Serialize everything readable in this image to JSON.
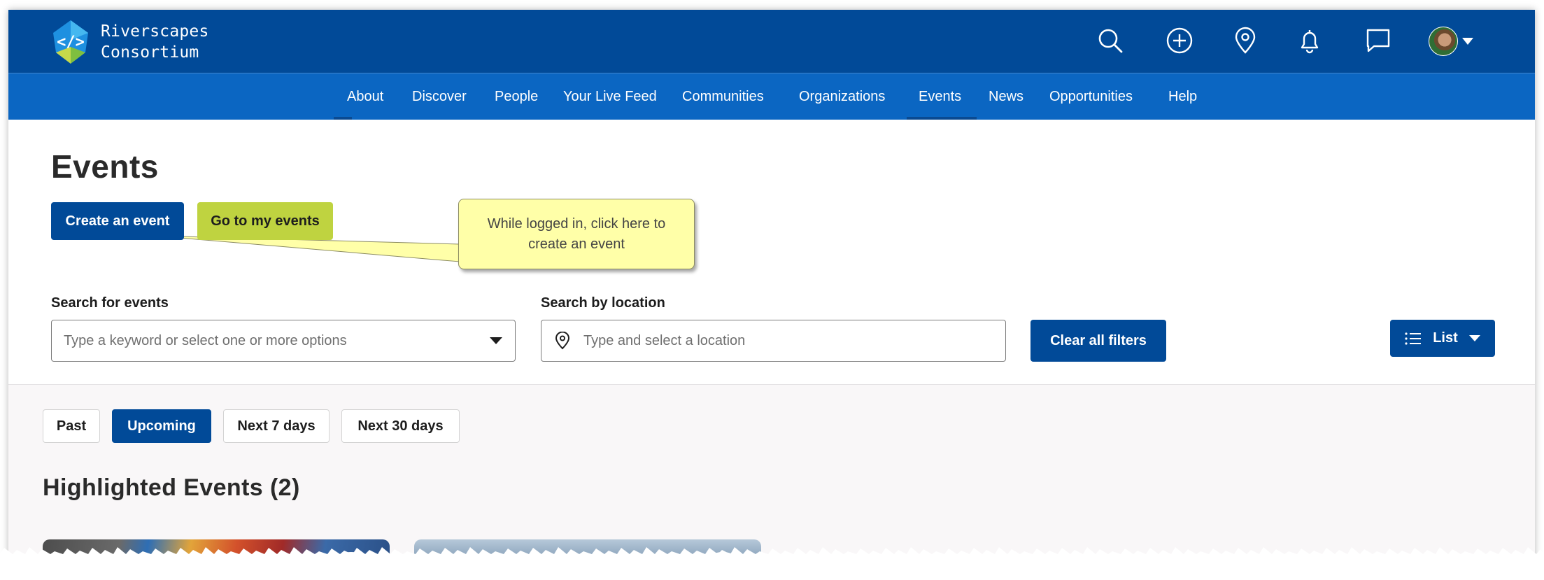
{
  "brand": {
    "name_line1": "Riverscapes",
    "name_line2": "Consortium",
    "logo_icon": "riverscapes-code-logo",
    "colors": {
      "header": "#014a98",
      "nav": "#0b66c2",
      "accent_lime": "#bfd340"
    }
  },
  "header_icons": [
    "search-icon",
    "add-circle-icon",
    "location-pin-icon",
    "bell-icon",
    "chat-bubble-icon"
  ],
  "nav": {
    "items": [
      {
        "label": "About"
      },
      {
        "label": "Discover"
      },
      {
        "label": "People"
      },
      {
        "label": "Your Live Feed"
      },
      {
        "label": "Communities"
      },
      {
        "label": "Organizations"
      },
      {
        "label": "Events",
        "active": true
      },
      {
        "label": "News"
      },
      {
        "label": "Opportunities"
      },
      {
        "label": "Help"
      }
    ]
  },
  "page": {
    "title": "Events",
    "create_button": "Create an event",
    "my_events_button": "Go to my events"
  },
  "callout": {
    "text": "While logged in, click here to create an event"
  },
  "search": {
    "events_label": "Search for events",
    "events_placeholder": "Type a keyword or select one or more options",
    "location_label": "Search by location",
    "location_placeholder": "Type and select a location",
    "clear_button": "Clear all filters",
    "view_toggle": "List"
  },
  "filters": {
    "tabs": [
      {
        "label": "Past",
        "active": false
      },
      {
        "label": "Upcoming",
        "active": true
      },
      {
        "label": "Next 7 days",
        "active": false
      },
      {
        "label": "Next 30 days",
        "active": false
      }
    ]
  },
  "highlighted": {
    "title": "Highlighted Events (2)"
  }
}
